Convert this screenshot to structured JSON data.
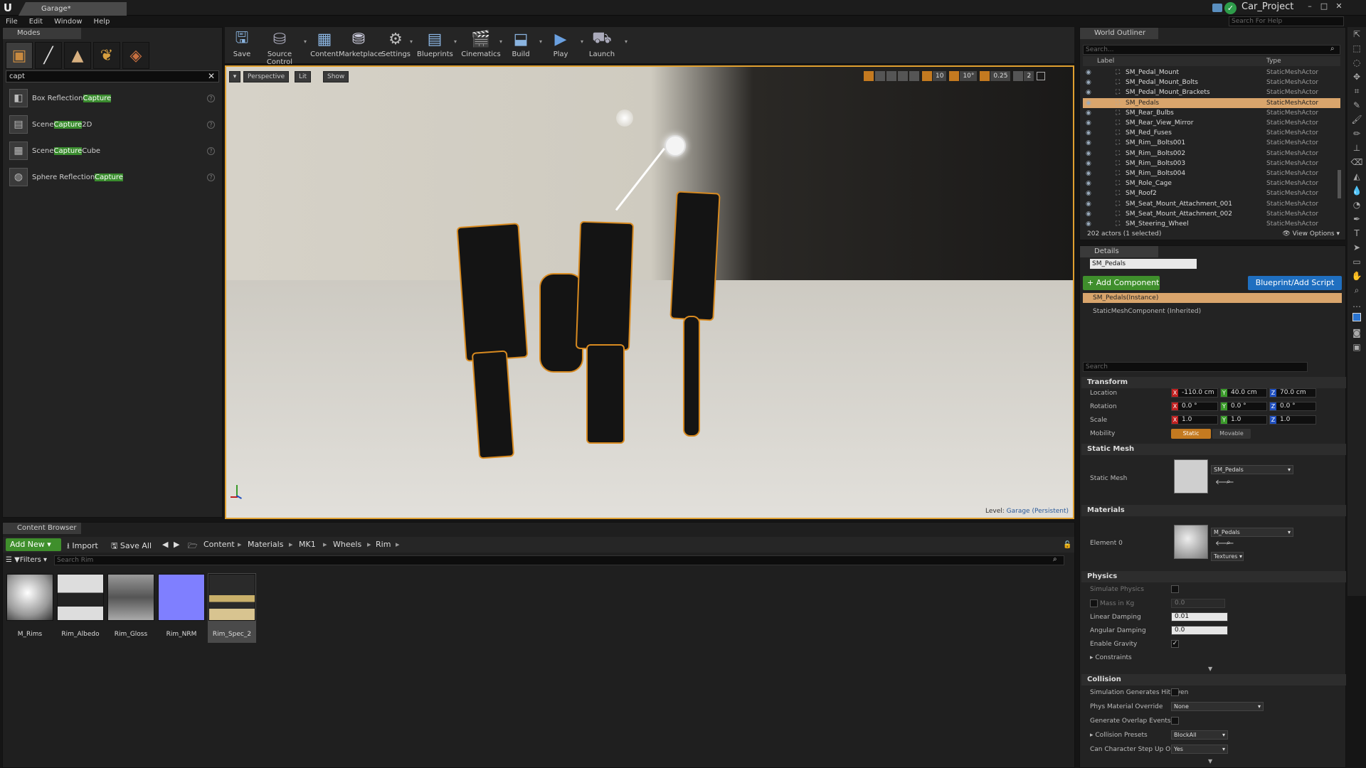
{
  "titlebar": {
    "doc_tab": "Garage*",
    "project": "Car_Project",
    "help_search_placeholder": "Search For Help",
    "min": "–",
    "max": "□",
    "close": "✕"
  },
  "menu": [
    "File",
    "Edit",
    "Window",
    "Help"
  ],
  "modes": {
    "tab": "Modes",
    "search_value": "capt",
    "items": [
      {
        "pre": "Box Reflection ",
        "hl": "Capture",
        "post": ""
      },
      {
        "pre": "Scene ",
        "hl": "Capture",
        "post": " 2D"
      },
      {
        "pre": "Scene ",
        "hl": "Capture",
        "post": " Cube"
      },
      {
        "pre": "Sphere Reflection ",
        "hl": "Capture",
        "post": ""
      }
    ]
  },
  "toolbar": {
    "save": "Save",
    "source_control": "Source Control",
    "content": "Content",
    "marketplace": "Marketplace",
    "settings": "Settings",
    "blueprints": "Blueprints",
    "cinematics": "Cinematics",
    "build": "Build",
    "play": "Play",
    "launch": "Launch"
  },
  "viewport": {
    "perspective": "Perspective",
    "lit": "Lit",
    "show": "Show",
    "level_label": "Level:",
    "level_name": "Garage (Persistent)",
    "grid_snap": "10",
    "rot_snap": "10°",
    "scale_snap": "0.25",
    "cam_speed": "2"
  },
  "outliner": {
    "tab": "World Outliner",
    "search_placeholder": "Search...",
    "col_label": "Label",
    "col_type": "Type",
    "rows": [
      {
        "label": "SM_Pedal_Mount",
        "type": "StaticMeshActor"
      },
      {
        "label": "SM_Pedal_Mount_Bolts",
        "type": "StaticMeshActor"
      },
      {
        "label": "SM_Pedal_Mount_Brackets",
        "type": "StaticMeshActor"
      },
      {
        "label": "SM_Pedals",
        "type": "StaticMeshActor"
      },
      {
        "label": "SM_Rear_Bulbs",
        "type": "StaticMeshActor"
      },
      {
        "label": "SM_Rear_View_Mirror",
        "type": "StaticMeshActor"
      },
      {
        "label": "SM_Red_Fuses",
        "type": "StaticMeshActor"
      },
      {
        "label": "SM_Rim__Bolts001",
        "type": "StaticMeshActor"
      },
      {
        "label": "SM_Rim__Bolts002",
        "type": "StaticMeshActor"
      },
      {
        "label": "SM_Rim__Bolts003",
        "type": "StaticMeshActor"
      },
      {
        "label": "SM_Rim__Bolts004",
        "type": "StaticMeshActor"
      },
      {
        "label": "SM_Role_Cage",
        "type": "StaticMeshActor"
      },
      {
        "label": "SM_Roof2",
        "type": "StaticMeshActor"
      },
      {
        "label": "SM_Seat_Mount_Attachment_001",
        "type": "StaticMeshActor"
      },
      {
        "label": "SM_Seat_Mount_Attachment_002",
        "type": "StaticMeshActor"
      },
      {
        "label": "SM_Steering_Wheel",
        "type": "StaticMeshActor"
      }
    ],
    "count": "202 actors (1 selected)",
    "view_options": "View Options"
  },
  "details": {
    "tab": "Details",
    "name": "SM_Pedals",
    "add_component": "+ Add Component",
    "blueprint_script": "Blueprint/Add Script",
    "instance": "SM_Pedals(Instance)",
    "component": "StaticMeshComponent (Inherited)",
    "search_placeholder": "Search",
    "transform": {
      "header": "Transform",
      "location_label": "Location",
      "rotation_label": "Rotation",
      "scale_label": "Scale",
      "mobility_label": "Mobility",
      "location": [
        "-110.0 cm",
        "40.0 cm",
        "70.0 cm"
      ],
      "rotation": [
        "0.0 °",
        "0.0 °",
        "0.0 °"
      ],
      "scale": [
        "1.0",
        "1.0",
        "1.0"
      ],
      "static": "Static",
      "movable": "Movable"
    },
    "static_mesh": {
      "header": "Static Mesh",
      "label": "Static Mesh",
      "value": "SM_Pedals"
    },
    "materials": {
      "header": "Materials",
      "label": "Element 0",
      "value": "M_Pedals",
      "textures": "Textures"
    },
    "physics": {
      "header": "Physics",
      "simulate": "Simulate Physics",
      "mass": "Mass in Kg",
      "mass_value": "0.0",
      "linear_damping": "Linear Damping",
      "linear_value": "0.01",
      "angular_damping": "Angular Damping",
      "angular_value": "0.0",
      "gravity": "Enable Gravity",
      "constraints": "Constraints"
    },
    "collision": {
      "header": "Collision",
      "sim_hit": "Simulation Generates Hit Even",
      "phys_mat": "Phys Material Override",
      "phys_mat_value": "None",
      "overlap": "Generate Overlap Events",
      "presets": "Collision Presets",
      "presets_value": "BlockAll",
      "step_up": "Can Character Step Up On",
      "step_up_value": "Yes"
    }
  },
  "content_browser": {
    "tab": "Content Browser",
    "add_new": "Add New",
    "import": "Import",
    "save_all": "Save All",
    "path": [
      "Content",
      "Materials",
      "MK1",
      "Wheels",
      "Rim"
    ],
    "filters": "Filters",
    "search_placeholder": "Search Rim",
    "assets": [
      "M_Rims",
      "Rim_Albedo",
      "Rim_Gloss",
      "Rim_NRM",
      "Rim_Spec_2"
    ]
  }
}
